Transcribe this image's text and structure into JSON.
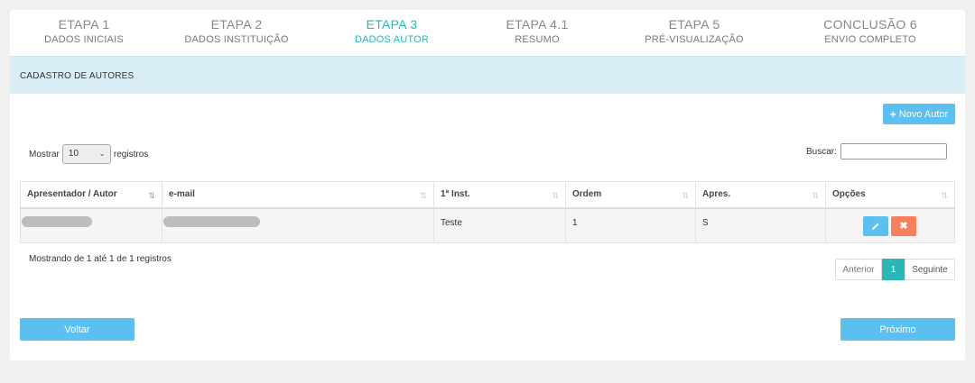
{
  "steps": [
    {
      "title": "ETAPA 1",
      "subtitle": "DADOS INICIAIS"
    },
    {
      "title": "ETAPA 2",
      "subtitle": "DADOS INSTITUIÇÃO"
    },
    {
      "title": "ETAPA 3",
      "subtitle": "DADOS AUTOR"
    },
    {
      "title": "ETAPA 4.1",
      "subtitle": "RESUMO"
    },
    {
      "title": "ETAPA 5",
      "subtitle": "PRÉ-VISUALIZAÇÃO"
    },
    {
      "title": "CONCLUSÃO 6",
      "subtitle": "ENVIO COMPLETO"
    }
  ],
  "active_step": "ETAPA 3",
  "panel": {
    "title": "CADASTRO DE AUTORES"
  },
  "toolbar": {
    "new_author_label": "Novo Autor"
  },
  "length": {
    "prefix": "Mostrar",
    "value": "10",
    "suffix": "registros"
  },
  "search": {
    "label": "Buscar:",
    "value": ""
  },
  "table": {
    "columns": [
      "Apresentador / Autor",
      "e-mail",
      "1ª Inst.",
      "Ordem",
      "Apres.",
      "Opções"
    ],
    "rows": [
      {
        "author": "",
        "email": "",
        "inst": "Teste",
        "order": "1",
        "apres": "S"
      }
    ]
  },
  "info": "Mostrando de 1 até 1 de 1 registros",
  "pagination": {
    "prev": "Anterior",
    "current": "1",
    "next": "Seguinte"
  },
  "nav": {
    "back": "Voltar",
    "next": "Próximo"
  },
  "colors": {
    "accent": "#2bb5b5",
    "button": "#5bc0f0",
    "danger": "#f5805e",
    "panel_bg": "#d9edf7"
  }
}
